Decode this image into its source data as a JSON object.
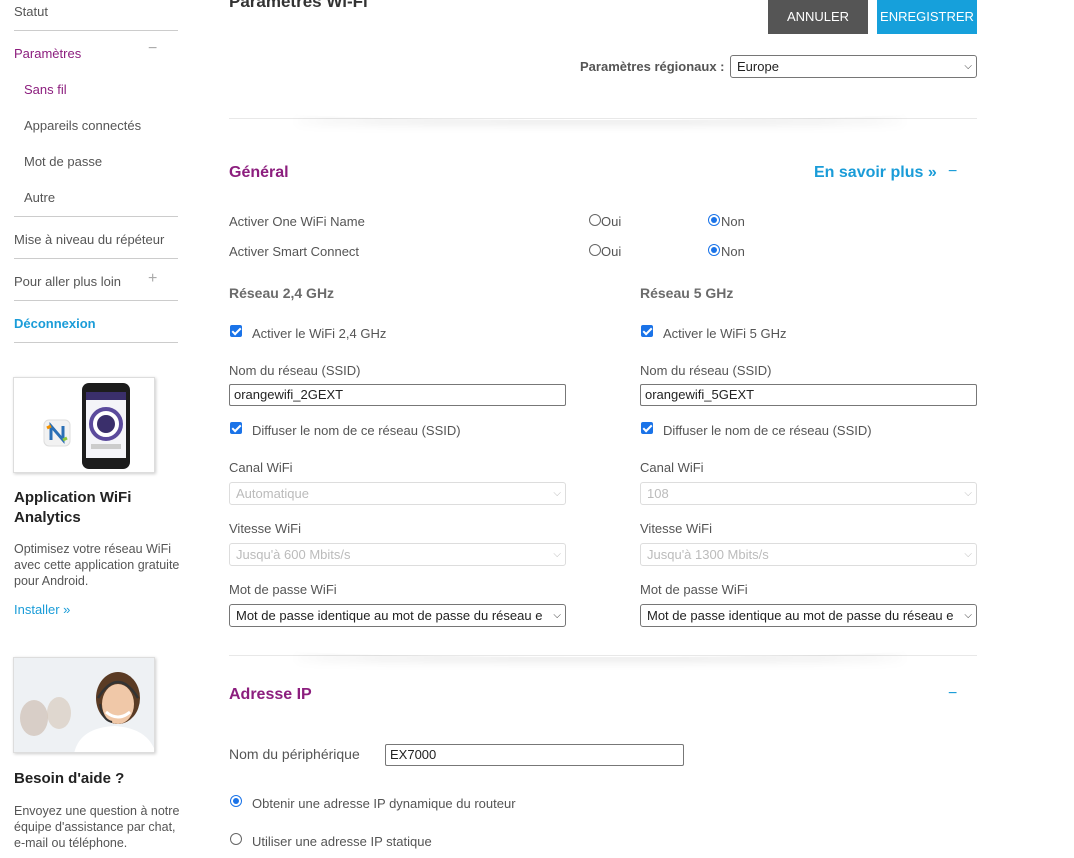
{
  "sidebar": {
    "status": "Statut",
    "settings": "Paramètres",
    "settings_toggle": "−",
    "wireless": "Sans fil",
    "connected_devices": "Appareils connectés",
    "password": "Mot de passe",
    "other": "Autre",
    "upgrade": "Mise à niveau du répéteur",
    "more": "Pour aller plus loin",
    "more_toggle": "+",
    "logout": "Déconnexion"
  },
  "promo_app": {
    "title": "Application WiFi Analytics",
    "text": "Optimisez votre réseau WiFi avec cette application gratuite pour Android.",
    "link": "Installer »"
  },
  "promo_help": {
    "title": "Besoin d'aide ?",
    "text": "Envoyez une question à notre équipe d'assistance par chat, e-mail ou téléphone."
  },
  "header": {
    "title": "Paramètres Wi-Fi",
    "cancel": "ANNULER",
    "save": "ENREGISTRER",
    "region_label": "Paramètres régionaux :",
    "region_value": "Europe"
  },
  "general": {
    "title": "Général",
    "learn_more": "En savoir plus »",
    "collapse": "−",
    "one_wifi_label": "Activer One WiFi Name",
    "smart_connect_label": "Activer Smart Connect",
    "yes": "Oui",
    "no": "Non"
  },
  "band24": {
    "title": "Réseau 2,4 GHz",
    "enable": "Activer le WiFi 2,4 GHz",
    "ssid_label": "Nom du réseau (SSID)",
    "ssid_value": "orangewifi_2GEXT",
    "broadcast": "Diffuser le nom de ce réseau (SSID)",
    "channel_label": "Canal WiFi",
    "channel_value": "Automatique",
    "speed_label": "Vitesse WiFi",
    "speed_value": "Jusqu'à 600 Mbits/s",
    "pwd_label": "Mot de passe WiFi",
    "pwd_value": "Mot de passe identique au mot de passe du réseau e"
  },
  "band5": {
    "title": "Réseau 5 GHz",
    "enable": "Activer le WiFi 5 GHz",
    "ssid_label": "Nom du réseau (SSID)",
    "ssid_value": "orangewifi_5GEXT",
    "broadcast": "Diffuser le nom de ce réseau (SSID)",
    "channel_label": "Canal WiFi",
    "channel_value": "108",
    "speed_label": "Vitesse WiFi",
    "speed_value": "Jusqu'à 1300 Mbits/s",
    "pwd_label": "Mot de passe WiFi",
    "pwd_value": "Mot de passe identique au mot de passe du réseau e"
  },
  "ip": {
    "title": "Adresse IP",
    "collapse": "−",
    "device_label": "Nom du périphérique",
    "device_value": "EX7000",
    "dynamic": "Obtenir une adresse IP dynamique du routeur",
    "static": "Utiliser une adresse IP statique"
  },
  "colors": {
    "accent_purple": "#8c1e7e",
    "accent_blue": "#1a9cd8",
    "button_dark": "#555555"
  }
}
